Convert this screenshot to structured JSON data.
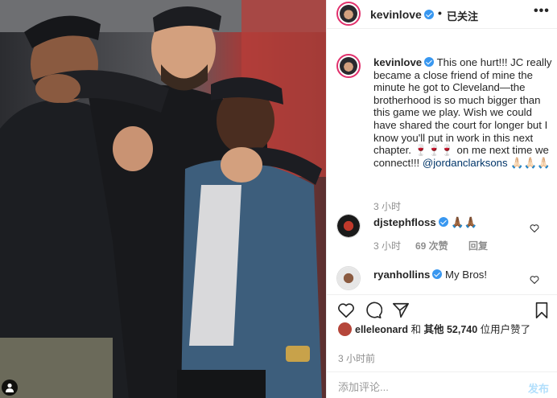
{
  "colors": {
    "verified": "#3897f0",
    "link": "#003569",
    "secondary_text": "#8e8e8e",
    "post_button_disabled": "#b2dffc",
    "story_ring": "#e1306c"
  },
  "photo": {
    "user_tag_icon": "person-icon"
  },
  "header": {
    "username": "kevinlove",
    "separator": "•",
    "follow_status": "已关注",
    "more": "•••"
  },
  "caption": {
    "username": "kevinlove",
    "text": "This one hurt!!! JC really became a close friend of mine the minute he got to Cleveland—the brotherhood is so much bigger than this game we play. Wish we could have shared the court for longer but I know you'll put in work in this next chapter. 🍷🍷🍷 on me next time we connect!!!",
    "mention": "@jordanclarksons",
    "emoji_suffix": " 🙏🏻🙏🏻🙏🏻",
    "time": "3 小时"
  },
  "comments": [
    {
      "username": "djstephfloss",
      "text": "🙏🏾🙏🏾",
      "time": "3 小时",
      "likes": "69 次赞",
      "reply": "回复"
    },
    {
      "username": "ryanhollins",
      "text": "My Bros!"
    }
  ],
  "actions": {
    "like_icon": "heart-icon",
    "comment_icon": "comment-icon",
    "share_icon": "share-icon",
    "save_icon": "bookmark-icon"
  },
  "likes": {
    "first_user": "elleleonard",
    "connector": " 和 ",
    "others_prefix": "其他 ",
    "count": "52,740",
    "suffix": " 位用户赞了"
  },
  "timestamp": "3 小时前",
  "comment_box": {
    "placeholder": "添加评论...",
    "post_label": "发布"
  }
}
